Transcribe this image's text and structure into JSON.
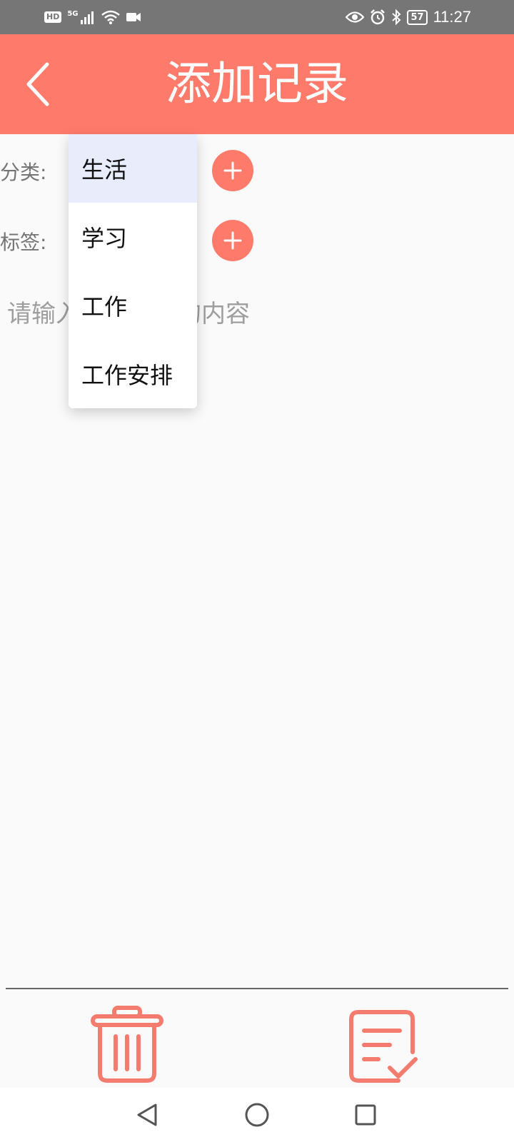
{
  "status_bar": {
    "hd_badge": "HD",
    "network": "5G",
    "battery": "57",
    "time": "11:27"
  },
  "app_bar": {
    "title": "添加记录",
    "back_icon": "chevron-left-icon"
  },
  "form": {
    "category_label": "分类:",
    "tag_label": "标签:",
    "add_icon": "plus-icon",
    "content_placeholder": "请输入你想记录的内容"
  },
  "dropdown": {
    "selected_index": 0,
    "options": [
      "生活",
      "学习",
      "工作",
      "工作安排"
    ]
  },
  "bottom_actions": {
    "delete_icon": "trash-icon",
    "save_icon": "note-check-icon"
  },
  "nav_bar": {
    "back_icon": "triangle-back-icon",
    "home_icon": "circle-home-icon",
    "recents_icon": "square-recents-icon"
  },
  "colors": {
    "accent": "#fe7b6c",
    "status_bar": "#767676",
    "selected_option": "#e8ecfb"
  }
}
